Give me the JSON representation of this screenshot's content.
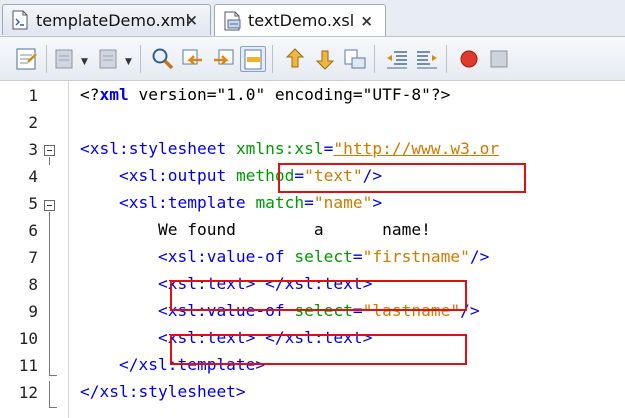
{
  "tabs": [
    {
      "label": "templateDemo.xml",
      "active": false,
      "close": "×"
    },
    {
      "label": "textDemo.xsl",
      "active": true,
      "close": "×"
    }
  ],
  "toolbar": {
    "icons": [
      "last-edit-icon",
      "back-icon",
      "forward-icon",
      "find-icon",
      "find-previous-icon",
      "find-next-icon",
      "toggle-highlight-icon",
      "previous-bookmark-icon",
      "next-bookmark-icon",
      "toggle-bookmark-icon",
      "shift-left-icon",
      "shift-right-icon",
      "start-macro-icon",
      "stop-macro-icon"
    ]
  },
  "editor": {
    "lines": [
      {
        "n": "1",
        "segs": [
          [
            "pi",
            "<?"
          ],
          [
            "pi-b",
            "xml"
          ],
          [
            "pi",
            " version=\"1.0\" encoding=\"UTF-8\"?>"
          ]
        ]
      },
      {
        "n": "2",
        "segs": []
      },
      {
        "n": "3",
        "segs": [
          [
            "tag",
            "<xsl:stylesheet "
          ],
          [
            "attr",
            "xmlns:xsl"
          ],
          [
            "tag",
            "="
          ],
          [
            "url",
            "\"http://www.w3.or"
          ]
        ]
      },
      {
        "n": "4",
        "segs": [
          [
            "tag",
            "    <xsl:output "
          ],
          [
            "attr",
            "method"
          ],
          [
            "tag",
            "="
          ],
          [
            "val",
            "\"text\""
          ],
          [
            "tag",
            "/>"
          ]
        ]
      },
      {
        "n": "5",
        "segs": [
          [
            "tag",
            "    <xsl:template "
          ],
          [
            "attr",
            "match"
          ],
          [
            "tag",
            "="
          ],
          [
            "val",
            "\"name\""
          ],
          [
            "tag",
            ">"
          ]
        ]
      },
      {
        "n": "6",
        "segs": [
          [
            "txt",
            "        We found        a      name!"
          ]
        ]
      },
      {
        "n": "7",
        "segs": [
          [
            "tag",
            "        <xsl:value-of "
          ],
          [
            "attr",
            "select"
          ],
          [
            "tag",
            "="
          ],
          [
            "val",
            "\"firstname\""
          ],
          [
            "tag",
            "/>"
          ]
        ]
      },
      {
        "n": "8",
        "segs": [
          [
            "tag",
            "        <xsl:text> </xsl:text>"
          ]
        ]
      },
      {
        "n": "9",
        "segs": [
          [
            "tag",
            "        <xsl:value-of "
          ],
          [
            "attr",
            "select"
          ],
          [
            "tag",
            "="
          ],
          [
            "val",
            "\"lastname\""
          ],
          [
            "tag",
            "/>"
          ]
        ]
      },
      {
        "n": "10",
        "segs": [
          [
            "tag",
            "        <xsl:text> </xsl:text>"
          ]
        ]
      },
      {
        "n": "11",
        "segs": [
          [
            "tag",
            "    </xsl:template>"
          ]
        ]
      },
      {
        "n": "12",
        "segs": [
          [
            "tag",
            "</xsl:stylesheet>"
          ]
        ]
      }
    ]
  },
  "colors": {
    "tag": "#0000e6",
    "attr": "#009900",
    "value": "#ce7b00",
    "highlight_box": "#e01010"
  }
}
